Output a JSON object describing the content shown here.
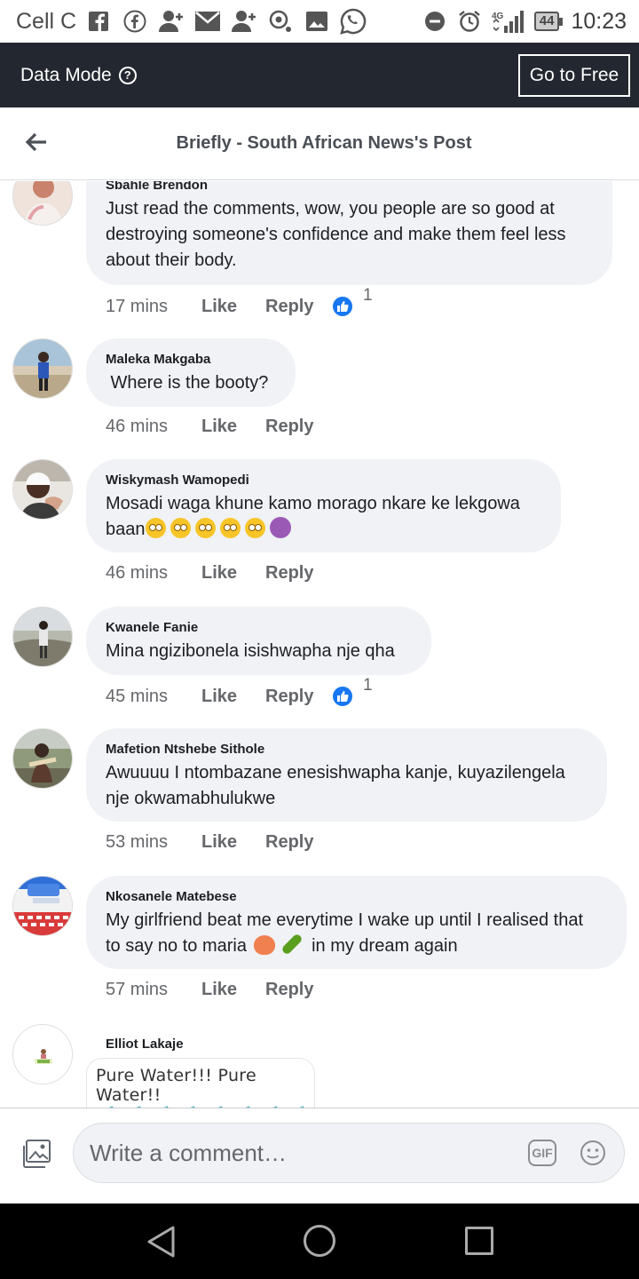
{
  "status_bar": {
    "carrier": "Cell C",
    "battery": "44",
    "time": "10:23",
    "network": "4G"
  },
  "data_mode_bar": {
    "label": "Data Mode",
    "help_icon": "?",
    "go_free_button": "Go to Free"
  },
  "header": {
    "title": "Briefly - South African News's Post"
  },
  "comments": [
    {
      "author": "Sbahle Brendon",
      "text": "Just read the comments, wow, you people  are so good at destroying someone's confidence and make them feel less about their body.",
      "time": "17 mins",
      "like_label": "Like",
      "reply_label": "Reply",
      "reactions": "1"
    },
    {
      "author": "Maleka Makgaba",
      "text": " Where is the booty?",
      "time": "46 mins",
      "like_label": "Like",
      "reply_label": "Reply"
    },
    {
      "author": "Wiskymash Wamopedi",
      "text_line1": "Mosadi waga khune kamo morago nkare ke lekgowa",
      "text_line2": "baan",
      "time": "46 mins",
      "like_label": "Like",
      "reply_label": "Reply"
    },
    {
      "author": "Kwanele Fanie",
      "text": "Mina ngizibonela isishwapha nje qha",
      "time": "45 mins",
      "like_label": "Like",
      "reply_label": "Reply",
      "reactions": "1"
    },
    {
      "author": "Mafetion Ntshebe Sithole",
      "text": "Awuuuu I ntombazane enesishwapha kanje, kuyazilengela nje okwamabhulukwe",
      "time": "53 mins",
      "like_label": "Like",
      "reply_label": "Reply"
    },
    {
      "author": "Nkosanele Matebese",
      "text_line1": "My girlfriend beat me everytime I wake up until I realised that",
      "text_line2_start": "to say no to maria",
      "text_line2_end": "in my dream again",
      "time": "57 mins",
      "like_label": "Like",
      "reply_label": "Reply"
    },
    {
      "author": "Elliot Lakaje",
      "sticker_text": "Pure Water!!! Pure Water!!"
    }
  ],
  "composer": {
    "placeholder": "Write a comment…",
    "gif_label": "GIF"
  },
  "colors": {
    "data_bar_bg": "#23272f",
    "bubble_bg": "#f0f2f5",
    "like_blue": "#1877f2",
    "meta_gray": "#65676b"
  },
  "icons": [
    "facebook-square-icon",
    "facebook-circle-icon",
    "add-friend-icon",
    "mail-icon",
    "gallery-icon",
    "whatsapp-icon",
    "do-not-disturb-icon",
    "alarm-icon",
    "signal-icon",
    "back-arrow-icon",
    "thumbs-up-icon",
    "photo-icon",
    "gif-icon",
    "emoji-icon"
  ]
}
